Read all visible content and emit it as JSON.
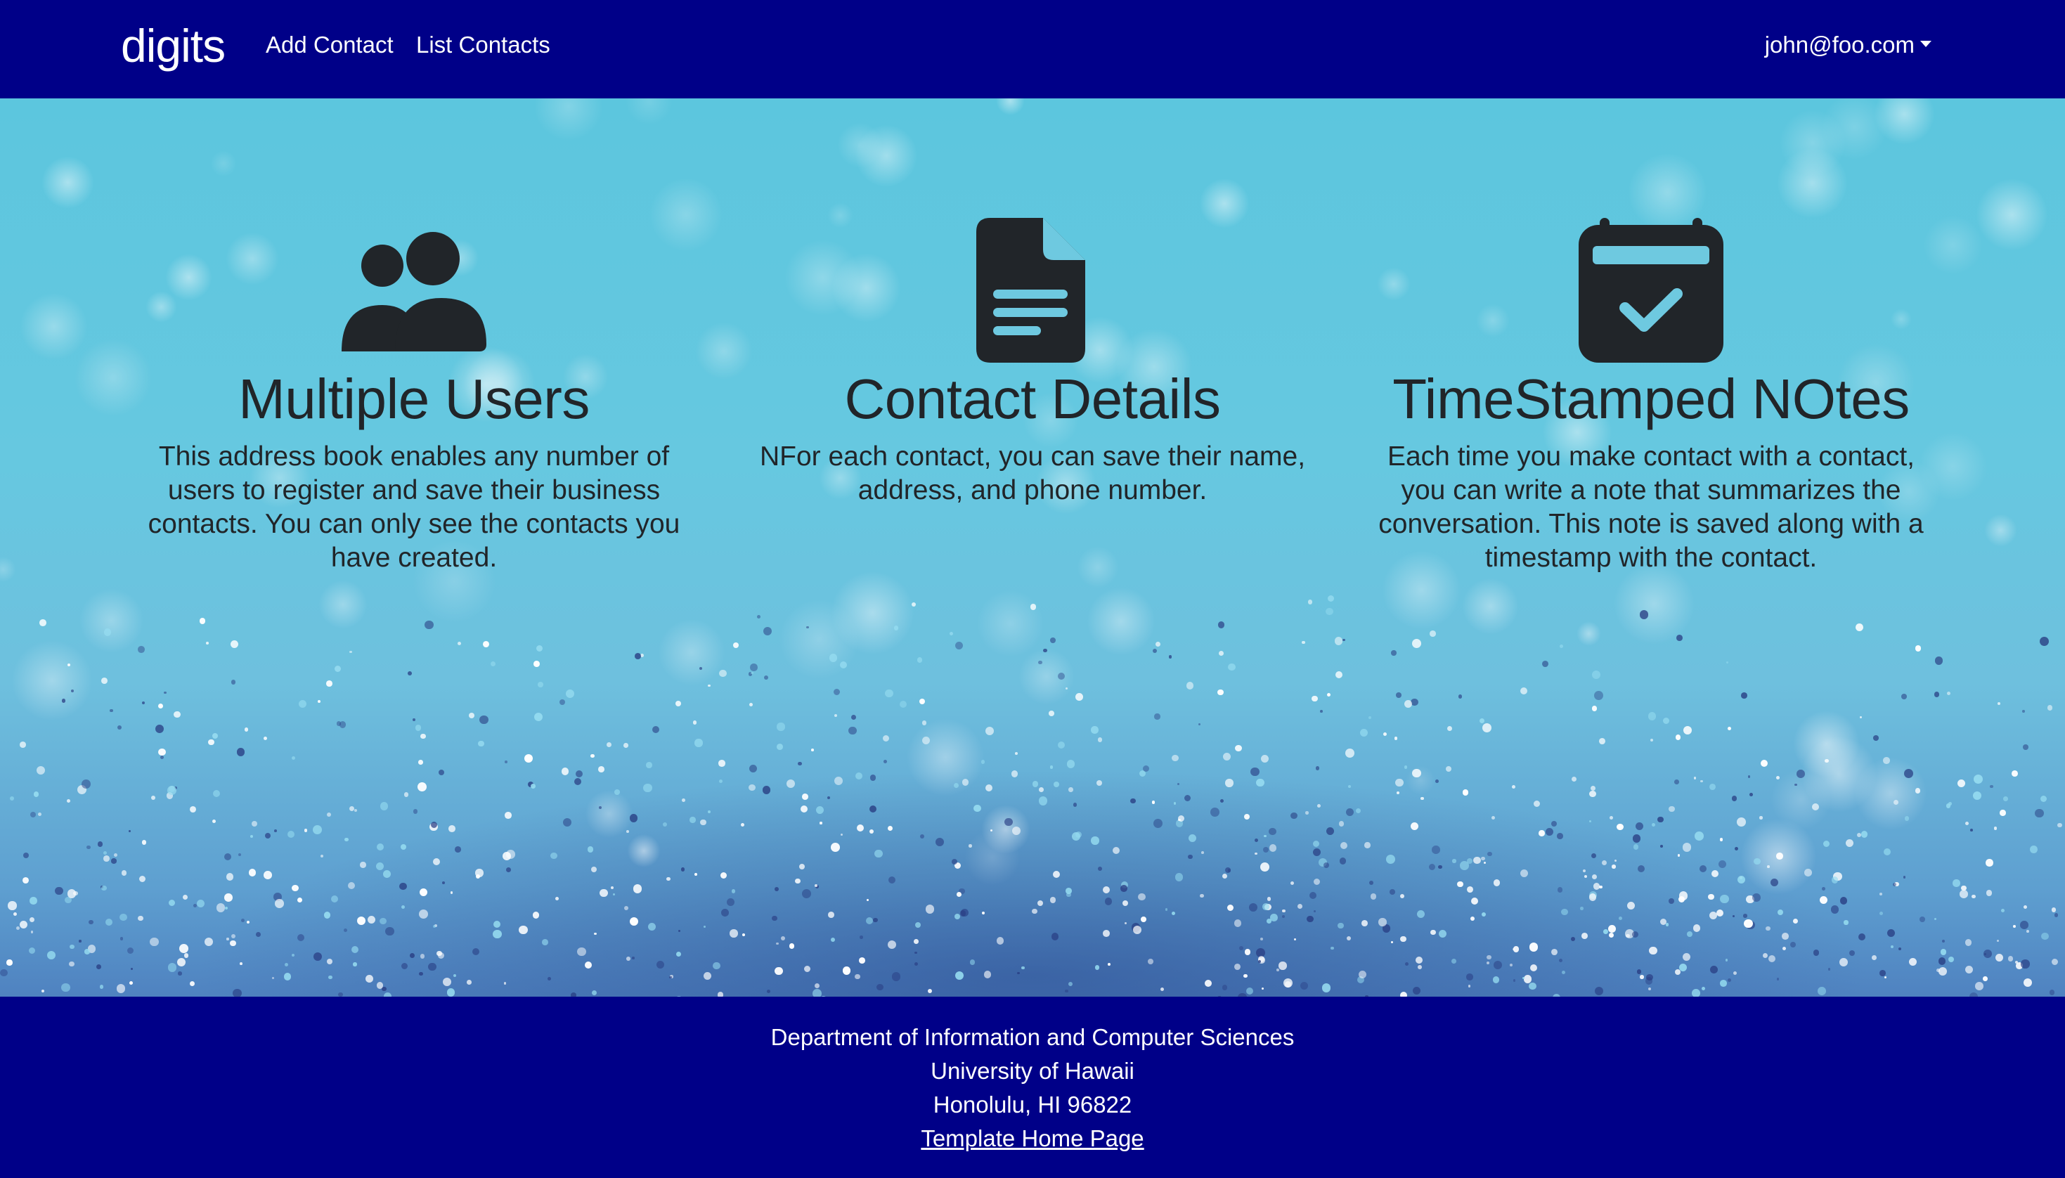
{
  "navbar": {
    "brand": "digits",
    "links": [
      "Add Contact",
      "List Contacts"
    ],
    "user_menu": "john@foo.com"
  },
  "features": [
    {
      "icon": "users-icon",
      "title": "Multiple Users",
      "text": "This address book enables any number of users to register and save their business contacts. You can only see the contacts you have created."
    },
    {
      "icon": "file-lines-icon",
      "title": "Contact Details",
      "text": "NFor each contact, you can save their name, address, and phone number."
    },
    {
      "icon": "calendar-check-icon",
      "title": "TimeStamped NOtes",
      "text": "Each time you make contact with a contact, you can write a note that summarizes the conversation. This note is saved along with a timestamp with the contact."
    }
  ],
  "footer": {
    "lines": [
      "Department of Information and Computer Sciences",
      "University of Hawaii",
      "Honolulu, HI 96822"
    ],
    "link_label": "Template Home Page"
  },
  "colors": {
    "navbar_bg": "#000088",
    "footer_bg": "#000088",
    "text_dark": "#212529",
    "icon_dark": "#212529",
    "background_main": "#66c8e0"
  }
}
